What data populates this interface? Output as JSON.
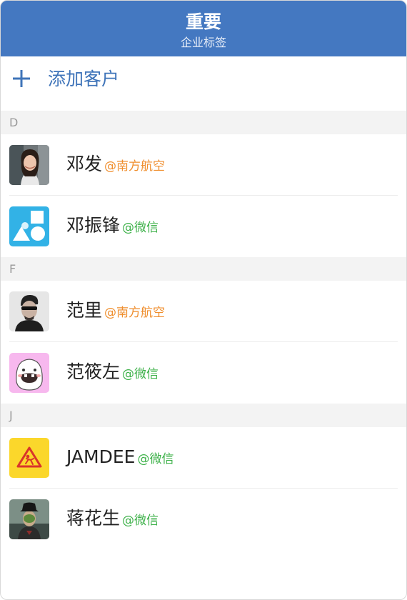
{
  "header": {
    "title": "重要",
    "subtitle": "企业标签"
  },
  "add_customer": {
    "label": "添加客户",
    "icon": "plus-icon"
  },
  "colors": {
    "header_bg": "#4478c1",
    "accent": "#3f74b9",
    "tag_orange": "#ef8e2d",
    "tag_green": "#3db149"
  },
  "sections": [
    {
      "letter": "D",
      "contacts": [
        {
          "name": "邓发",
          "tag": "@南方航空",
          "tag_color": "orange",
          "avatar": "woman-portrait-avatar"
        },
        {
          "name": "邓振锋",
          "tag": "@微信",
          "tag_color": "green",
          "avatar": "shapes-avatar"
        }
      ]
    },
    {
      "letter": "F",
      "contacts": [
        {
          "name": "范里",
          "tag": "@南方航空",
          "tag_color": "orange",
          "avatar": "man-sunglasses-avatar"
        },
        {
          "name": "范筱左",
          "tag": "@微信",
          "tag_color": "green",
          "avatar": "cartoon-face-avatar"
        }
      ]
    },
    {
      "letter": "J",
      "contacts": [
        {
          "name": "JAMDEE",
          "tag": "@微信",
          "tag_color": "green",
          "avatar": "warning-sign-avatar"
        },
        {
          "name": "蒋花生",
          "tag": "@微信",
          "tag_color": "green",
          "avatar": "bowler-hat-avatar"
        }
      ]
    }
  ]
}
